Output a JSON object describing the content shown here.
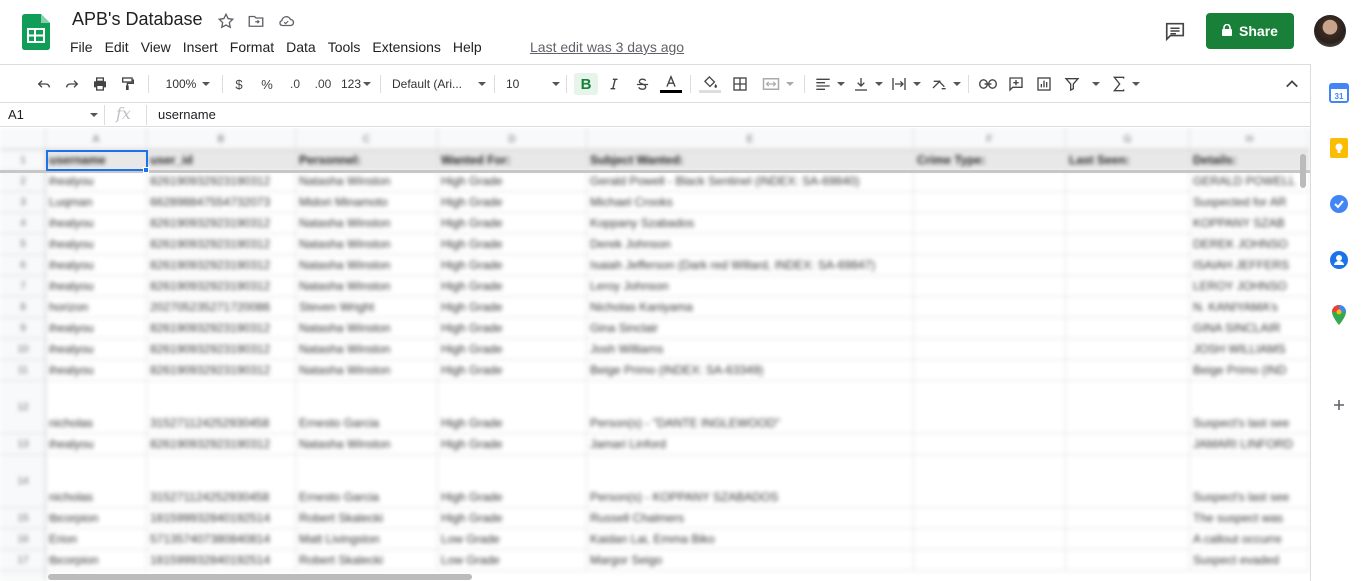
{
  "app": {
    "title": "APB's Database",
    "last_edit": "Last edit was 3 days ago",
    "share_label": "Share"
  },
  "menu": [
    "File",
    "Edit",
    "View",
    "Insert",
    "Format",
    "Data",
    "Tools",
    "Extensions",
    "Help"
  ],
  "toolbar": {
    "zoom": "100%",
    "currency": "$",
    "percent": "%",
    "decrease_decimal": ".0",
    "increase_decimal": ".00",
    "number_format": "123",
    "font": "Default (Ari...",
    "font_size": "10",
    "bold": "B"
  },
  "formula_bar": {
    "cell_ref": "A1",
    "fx": "fx",
    "value": "username"
  },
  "sheet": {
    "columns": [
      "A",
      "B",
      "C",
      "D",
      "E",
      "F",
      "G",
      "H"
    ],
    "header_row": [
      "username",
      "user_id",
      "Personnel:",
      "Wanted For:",
      "Subject Wanted:",
      "Crime Type:",
      "Last Seen:",
      "Details:"
    ],
    "rows": [
      {
        "num": "2",
        "cells": [
          "ihealyou",
          "826190932923190312",
          "Natasha Winston",
          "High Grade",
          "Gerald Powell - Black Sentinel (INDEX: SA-69840)",
          "",
          "",
          "GERALD POWELL"
        ]
      },
      {
        "num": "3",
        "cells": [
          "Luqman",
          "662898847554732073",
          "Midori Minamoto",
          "High Grade",
          "Michael Crooks",
          "",
          "",
          "Suspected for AR"
        ]
      },
      {
        "num": "4",
        "cells": [
          "ihealyou",
          "826190932923190312",
          "Natasha Winston",
          "High Grade",
          "Koppany Szabados",
          "",
          "",
          "KOPPANY SZAB"
        ]
      },
      {
        "num": "5",
        "cells": [
          "ihealyou",
          "826190932923190312",
          "Natasha Winston",
          "High Grade",
          "Derek Johnson",
          "",
          "",
          "DEREK JOHNSO"
        ]
      },
      {
        "num": "6",
        "cells": [
          "ihealyou",
          "826190932923190312",
          "Natasha Winston",
          "High Grade",
          "Isaiah Jefferson (Dark red Willard, INDEX: SA-69847)",
          "",
          "",
          "ISAIAH JEFFERS"
        ]
      },
      {
        "num": "7",
        "cells": [
          "ihealyou",
          "826190932923190312",
          "Natasha Winston",
          "High Grade",
          "Leroy Johnson",
          "",
          "",
          "LEROY JOHNSO"
        ]
      },
      {
        "num": "8",
        "cells": [
          "horizon",
          "202705235271720086",
          "Steven Wright",
          "High Grade",
          "Nicholas Kaniyama",
          "",
          "",
          "N. KANIYAMA's"
        ]
      },
      {
        "num": "9",
        "cells": [
          "ihealyou",
          "826190932923190312",
          "Natasha Winston",
          "High Grade",
          "Gina Sinclair",
          "",
          "",
          "GINA SINCLAIR"
        ]
      },
      {
        "num": "10",
        "cells": [
          "ihealyou",
          "826190932923190312",
          "Natasha Winston",
          "High Grade",
          "Josh Williams",
          "",
          "",
          "JOSH WILLIAMS"
        ]
      },
      {
        "num": "11",
        "cells": [
          "ihealyou",
          "826190932923190312",
          "Natasha Winston",
          "High Grade",
          "Beige Primo (INDEX: SA-63349)",
          "",
          "",
          "Beige Primo (IND"
        ]
      },
      {
        "num": "12",
        "cells": [
          "nicholas",
          "315271124252930458",
          "Ernesto Garcia",
          "High Grade",
          "Person(s) - \"DANTE INGLEWOOD\"",
          "",
          "",
          "Suspect's last see"
        ]
      },
      {
        "num": "13",
        "cells": [
          "ihealyou",
          "826190932923190312",
          "Natasha Winston",
          "High Grade",
          "Jamari Linford",
          "",
          "",
          "JAMARI LINFORD"
        ]
      },
      {
        "num": "14",
        "cells": [
          "nicholas",
          "315271124252930458",
          "Ernesto Garcia",
          "High Grade",
          "Person(s) - KOPPANY SZABADOS",
          "",
          "",
          "Suspect's last see"
        ]
      },
      {
        "num": "15",
        "cells": [
          "tbcorpion",
          "181599932840192514",
          "Robert Skalecki",
          "High Grade",
          "Russell Chalmers",
          "",
          "",
          "The suspect was"
        ]
      },
      {
        "num": "16",
        "cells": [
          "Erion",
          "571357407380840814",
          "Matt Livingston",
          "Low Grade",
          "Kaidan Lai, Emma Biko",
          "",
          "",
          "A callout occurre"
        ]
      },
      {
        "num": "17",
        "cells": [
          "tbcorpion",
          "181599932840192514",
          "Robert Skalecki",
          "Low Grade",
          "Margor Seigo",
          "",
          "",
          "Suspect evaded"
        ]
      }
    ]
  },
  "icons": {
    "app": "google-sheets-icon",
    "side": [
      "calendar-icon",
      "keep-icon",
      "tasks-icon",
      "contacts-icon",
      "maps-icon",
      "add-icon"
    ]
  },
  "colors": {
    "accent": "#188038",
    "selection": "#1a73e8"
  }
}
